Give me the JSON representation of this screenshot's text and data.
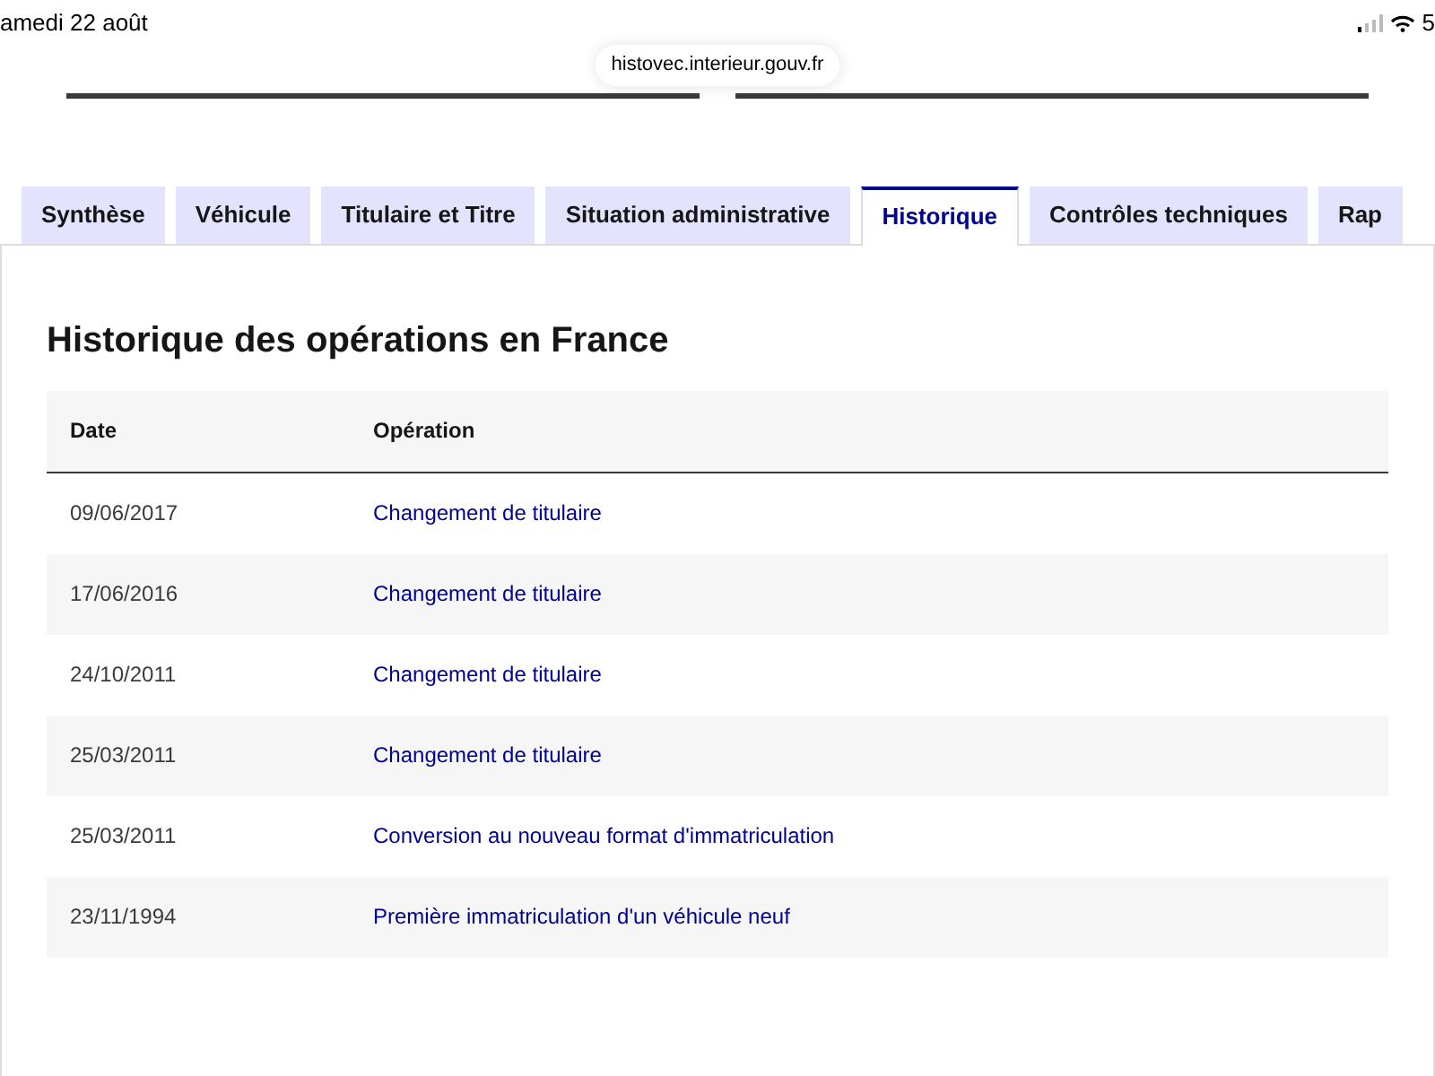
{
  "status_bar": {
    "date": "amedi 22 août",
    "battery": "5"
  },
  "url_bar": {
    "address": "histovec.interieur.gouv.fr"
  },
  "tabs": [
    {
      "label": "Synthèse",
      "selected": false
    },
    {
      "label": "Véhicule",
      "selected": false
    },
    {
      "label": "Titulaire et Titre",
      "selected": false
    },
    {
      "label": "Situation administrative",
      "selected": false
    },
    {
      "label": "Historique",
      "selected": true
    },
    {
      "label": "Contrôles techniques",
      "selected": false
    },
    {
      "label": "Rap",
      "selected": false
    }
  ],
  "section": {
    "title": "Historique des opérations en France"
  },
  "table": {
    "columns": [
      "Date",
      "Opération"
    ],
    "rows": [
      {
        "date": "09/06/2017",
        "operation": "Changement de titulaire"
      },
      {
        "date": "17/06/2016",
        "operation": "Changement de titulaire"
      },
      {
        "date": "24/10/2011",
        "operation": "Changement de titulaire"
      },
      {
        "date": "25/03/2011",
        "operation": "Changement de titulaire"
      },
      {
        "date": "25/03/2011",
        "operation": "Conversion au nouveau format d'immatriculation"
      },
      {
        "date": "23/11/1994",
        "operation": "Première immatriculation d'un véhicule neuf"
      }
    ]
  }
}
